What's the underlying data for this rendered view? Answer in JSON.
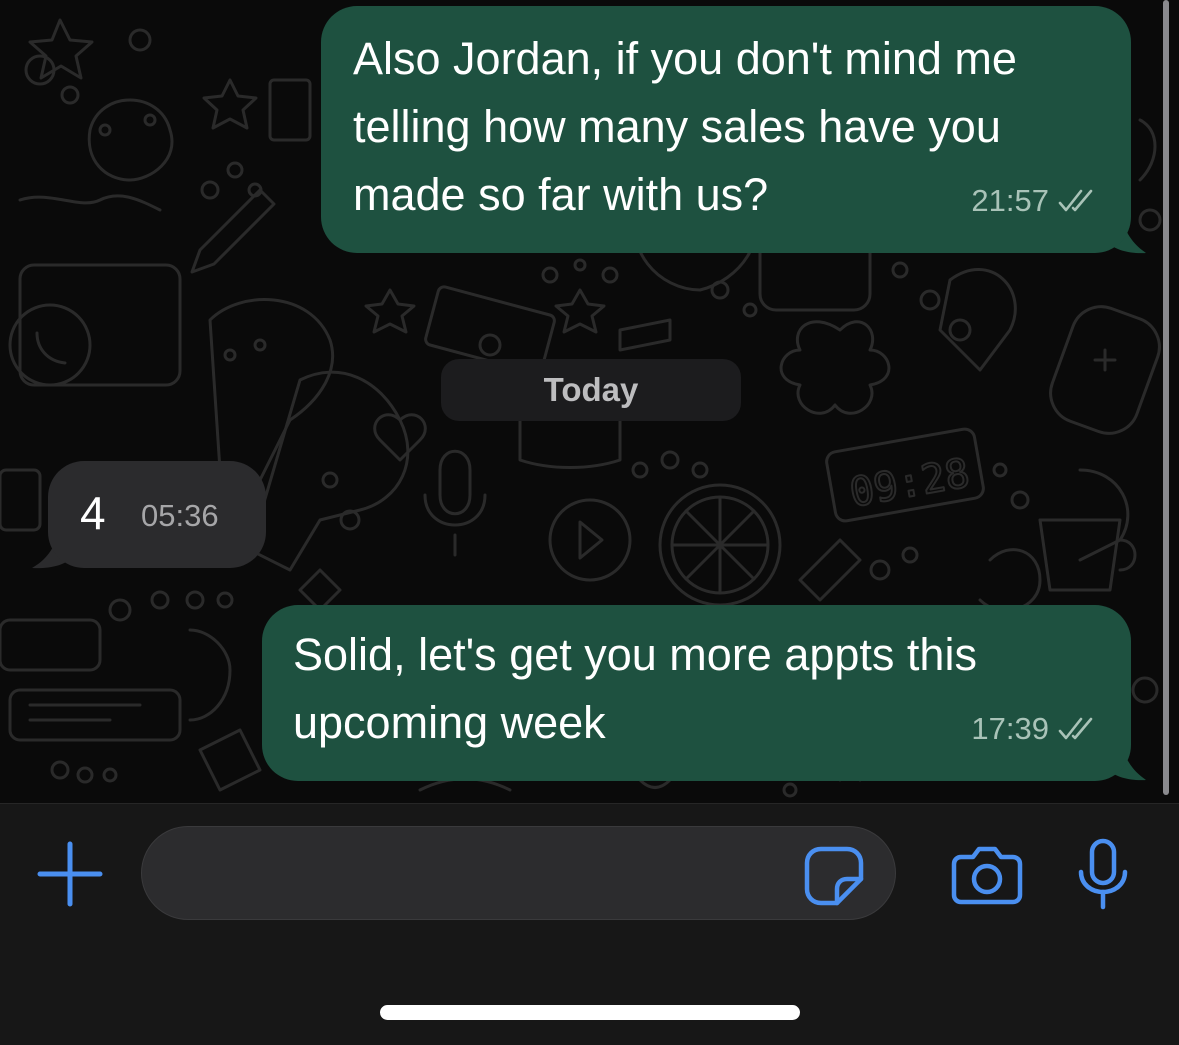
{
  "colors": {
    "accent": "#4a8ff0",
    "outgoing_bubble": "#1e5140",
    "incoming_bubble": "#2b2b2d",
    "background": "#0a0a0a"
  },
  "messages": [
    {
      "direction": "outgoing",
      "lines": [
        "Also Jordan, if you don't mind me",
        "telling how many sales have you",
        "made so far with us?"
      ],
      "time": "21:57",
      "status_icon": "double-check-icon"
    },
    {
      "direction": "incoming",
      "lines": [
        "4"
      ],
      "time": "05:36"
    },
    {
      "direction": "outgoing",
      "lines": [
        "Solid, let's get you more appts this",
        "upcoming week"
      ],
      "time": "17:39",
      "status_icon": "double-check-icon"
    }
  ],
  "date_separator": "Today",
  "wallpaper_clock": "09:28",
  "input_bar": {
    "message_value": "",
    "icons": [
      "plus-icon",
      "sticker-icon",
      "camera-icon",
      "microphone-icon"
    ]
  }
}
